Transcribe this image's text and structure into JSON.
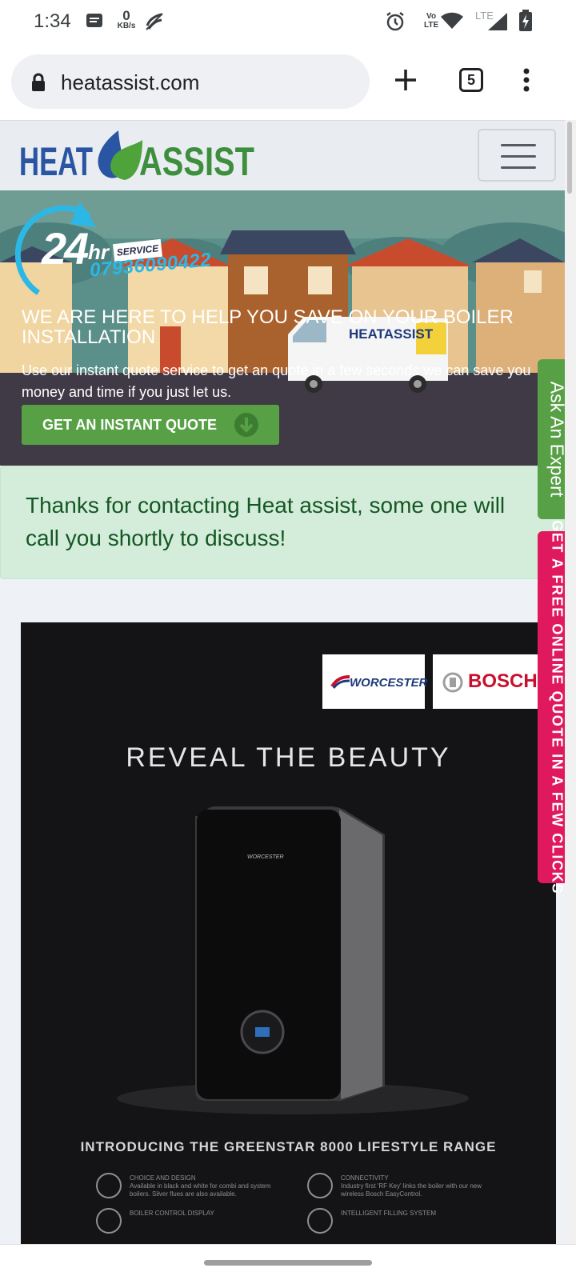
{
  "status_bar": {
    "time": "1:34",
    "kbs_value": "0",
    "kbs_unit": "KB/s",
    "volte_line1": "Vo",
    "volte_line2": "LTE",
    "network": "LTE",
    "icons": [
      "message-icon",
      "data-saver-off-icon",
      "alarm-icon",
      "wifi-icon",
      "signal-icon",
      "battery-icon"
    ]
  },
  "browser": {
    "url": "heatassist.com",
    "tab_count": "5"
  },
  "site": {
    "logo_left": "HEAT",
    "logo_right": "ASSIST",
    "brand_colors": {
      "blue": "#2a55a3",
      "green": "#3d8f3d"
    }
  },
  "hero": {
    "badge_number": "24",
    "badge_hr": "hr",
    "badge_service": "SERVICE",
    "phone": "07936090422",
    "heading": "WE ARE HERE TO HELP YOU SAVE ON YOUR BOILER INSTALLATION",
    "subtext": "Use our instant quote service to get an quote in a few seconds we can save you money and time if you just let us.",
    "cta": "GET AN INSTANT QUOTE",
    "van_label": "HEATASSIST"
  },
  "alert": {
    "message": "Thanks for contacting Heat assist, some one will call you shortly to discuss!"
  },
  "promo": {
    "brand1": "WORCESTER",
    "brand2": "BOSCH",
    "headline": "REVEAL THE BEAUTY",
    "boiler_brand": "WORCESTER",
    "tagline": "INTRODUCING THE GREENSTAR 8000 LIFESTYLE RANGE",
    "features": [
      {
        "title": "CHOICE AND DESIGN",
        "text": "Available in black and white for combi and system boilers. Silver flues are also available."
      },
      {
        "title": "CONNECTIVITY",
        "text": "Industry first 'RF Key' links the boiler with our new wireless Bosch EasyControl."
      },
      {
        "title": "BOILER CONTROL DISPLAY",
        "text": ""
      },
      {
        "title": "INTELLIGENT FILLING SYSTEM",
        "text": ""
      }
    ]
  },
  "side_tabs": {
    "expert": "Ask An Expert",
    "quote": "GET A FREE ONLINE QUOTE IN A FEW CLICKS"
  }
}
